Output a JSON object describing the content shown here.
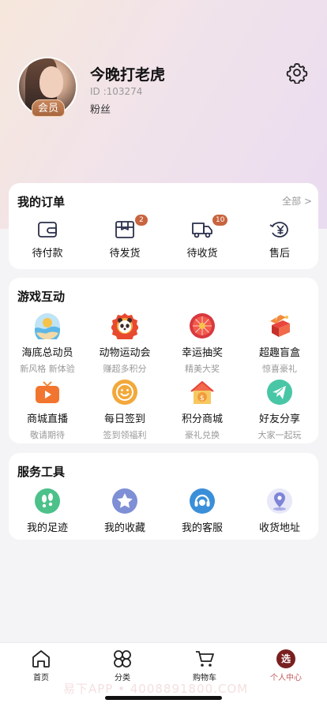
{
  "profile": {
    "vip_label": "会员",
    "username": "今晚打老虎",
    "user_id": "ID :103274",
    "fans_label": "粉丝"
  },
  "orders": {
    "title": "我的订单",
    "more_label": "全部 >",
    "items": [
      {
        "label": "待付款",
        "icon": "wallet-icon",
        "badge": ""
      },
      {
        "label": "待发货",
        "icon": "package-icon",
        "badge": "2"
      },
      {
        "label": "待收货",
        "icon": "delivery-truck-icon",
        "badge": "10"
      },
      {
        "label": "售后",
        "icon": "refund-yen-icon",
        "badge": ""
      }
    ]
  },
  "games": {
    "title": "游戏互动",
    "items": [
      {
        "label": "海底总动员",
        "sub": "新风格 新体验",
        "icon": "seabed-icon"
      },
      {
        "label": "动物运动会",
        "sub": "赚超多积分",
        "icon": "panda-icon"
      },
      {
        "label": "幸运抽奖",
        "sub": "精美大奖",
        "icon": "lucky-wheel-icon"
      },
      {
        "label": "超趣盲盒",
        "sub": "惊喜豪礼",
        "icon": "blind-box-icon"
      },
      {
        "label": "商城直播",
        "sub": "敬请期待",
        "icon": "live-tv-icon"
      },
      {
        "label": "每日签到",
        "sub": "签到领福利",
        "icon": "smile-checkin-icon"
      },
      {
        "label": "积分商城",
        "sub": "豪礼兑换",
        "icon": "points-shop-icon"
      },
      {
        "label": "好友分享",
        "sub": "大家一起玩",
        "icon": "share-plane-icon"
      }
    ]
  },
  "services": {
    "title": "服务工具",
    "items": [
      {
        "label": "我的足迹",
        "icon": "footprint-icon",
        "color": "#4cc18a"
      },
      {
        "label": "我的收藏",
        "icon": "star-icon",
        "color": "#7f8fd6"
      },
      {
        "label": "我的客服",
        "icon": "customer-service-icon",
        "color": "#3b8fd9"
      },
      {
        "label": "收货地址",
        "icon": "location-pin-icon",
        "color": "#7e84d8"
      }
    ]
  },
  "tabbar": {
    "items": [
      {
        "label": "首页",
        "icon": "home-icon"
      },
      {
        "label": "分类",
        "icon": "category-icon"
      },
      {
        "label": "购物车",
        "icon": "cart-icon"
      },
      {
        "label": "个人中心",
        "icon": "profile-tab-icon",
        "glyph": "选"
      }
    ]
  },
  "watermark": "易下APP • 4008891800.COM",
  "colors": {
    "accent": "#c8643f",
    "active_tab": "#c45a5a"
  }
}
